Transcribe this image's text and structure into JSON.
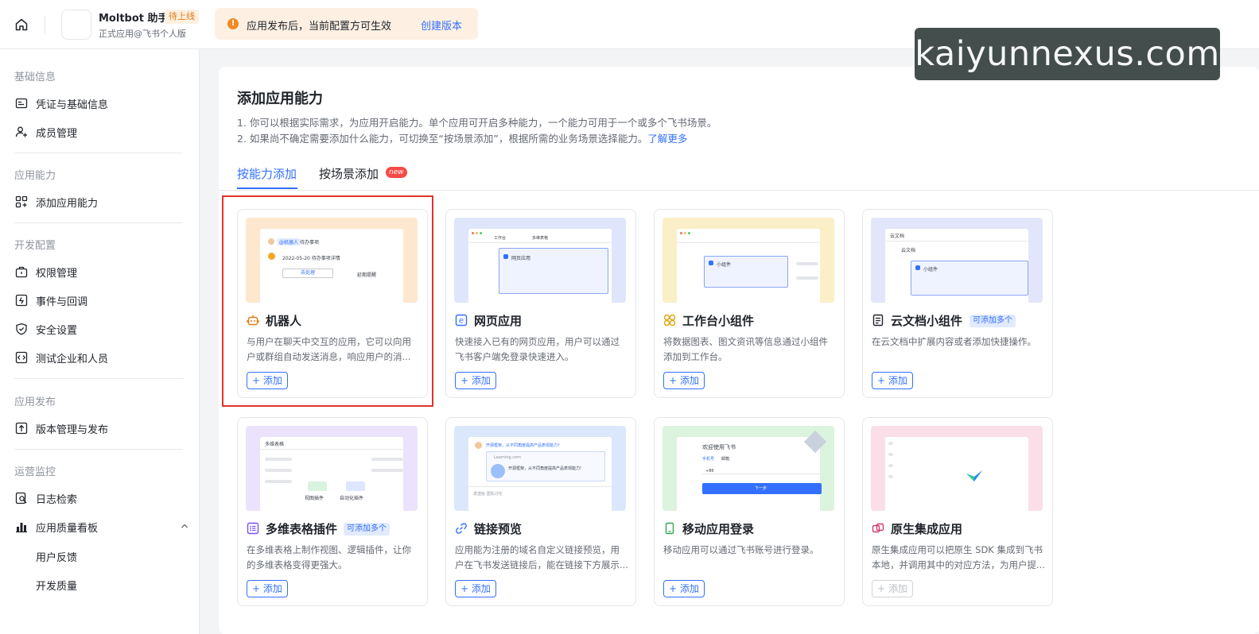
{
  "topbar": {
    "app_name": "Moltbot 助手",
    "app_badge": "待上线",
    "app_subtitle": "正式应用@飞书个人版",
    "notice_text": "应用发布后，当前配置方可生效",
    "notice_link": "创建版本"
  },
  "watermark": "kaiyunnexus.com",
  "sidebar": {
    "sections": [
      {
        "title": "基础信息",
        "items": [
          "凭证与基础信息",
          "成员管理"
        ]
      },
      {
        "title": "应用能力",
        "items": [
          "添加应用能力"
        ]
      },
      {
        "title": "开发配置",
        "items": [
          "权限管理",
          "事件与回调",
          "安全设置",
          "测试企业和人员"
        ]
      },
      {
        "title": "应用发布",
        "items": [
          "版本管理与发布"
        ]
      },
      {
        "title": "运营监控",
        "items": [
          "日志检索",
          "应用质量看板"
        ],
        "subitems": [
          "用户反馈",
          "开发质量"
        ]
      }
    ]
  },
  "main": {
    "title": "添加应用能力",
    "desc1": "1. 你可以根据实际需求，为应用开启能力。单个应用可开启多种能力，一个能力可用于一个或多个飞书场景。",
    "desc2": "2. 如果尚不确定需要添加什么能力，可切换至“按场景添加”，根据所需的业务场景选择能力。",
    "learn_more": "了解更多",
    "tabs": [
      "按能力添加",
      "按场景添加"
    ],
    "new_badge": "new",
    "add_label": "+ 添加",
    "multi_badge": "可添加多个",
    "cards": [
      {
        "title": "机器人",
        "desc": "与用户在聊天中交互的应用，它可以向用户或群组自动发送消息，响应用户的消...",
        "icon": "robot-icon",
        "thumb": "#fde8cf"
      },
      {
        "title": "网页应用",
        "desc": "快速接入已有的网页应用，用户可以通过飞书客户端免登录快速进入。",
        "icon": "web-app-icon",
        "thumb": "#dfe6fb"
      },
      {
        "title": "工作台小组件",
        "desc": "将数据图表、图文资讯等信息通过小组件添加到工作台。",
        "icon": "widget-icon",
        "thumb": "#fbefc8"
      },
      {
        "title": "云文档小组件",
        "desc": "在云文档中扩展内容或者添加快捷操作。",
        "icon": "doc-widget-icon",
        "thumb": "#e3e6fa"
      },
      {
        "title": "多维表格插件",
        "desc": "在多维表格上制作视图、逻辑插件，让你的多维表格变得更强大。",
        "icon": "bitable-plugin-icon",
        "thumb": "#ebe3fb"
      },
      {
        "title": "链接预览",
        "desc": "应用能为注册的域名自定义链接预览，用户在飞书发送链接后，能在链接下方展示...",
        "icon": "link-icon",
        "thumb": "#dbe8fb"
      },
      {
        "title": "移动应用登录",
        "desc": "移动应用可以通过飞书账号进行登录。",
        "icon": "mobile-icon",
        "thumb": "#dcf3de"
      },
      {
        "title": "原生集成应用",
        "desc": "原生集成应用可以把原生 SDK 集成到飞书本地，并调用其中的对应方法，为用户提...",
        "icon": "native-icon",
        "thumb": "#fbdfe8"
      }
    ],
    "thumbs": {
      "bot_tag": "@机器人",
      "bot_todo": "待办事项",
      "bot_date": "2022-05-20 待办事项详情",
      "bot_btn": "去处理",
      "bot_link": "延期提醒",
      "web_tab1": "工作台",
      "web_tab2": "多维表格",
      "web_label": "网页应用",
      "widget_label": "小组件",
      "doc_back": "云文档",
      "doc_title": "云文档",
      "doc_label": "小组件",
      "bitable_title": "多维表格",
      "bitable_btn1": "视图插件",
      "bitable_btn2": "自动化插件",
      "link_msg1": "开源框架，从不同角度提高产品表现能力?",
      "link_url": "Learning.com",
      "link_msg2": "开源框架，从不同角度提高产品表现能力!",
      "link_input": "发送给 团队讨论",
      "login_welcome": "欢迎使用飞书",
      "login_tab1": "手机号",
      "login_tab2": "邮箱",
      "login_code": "+86",
      "login_btn": "下一步"
    }
  }
}
